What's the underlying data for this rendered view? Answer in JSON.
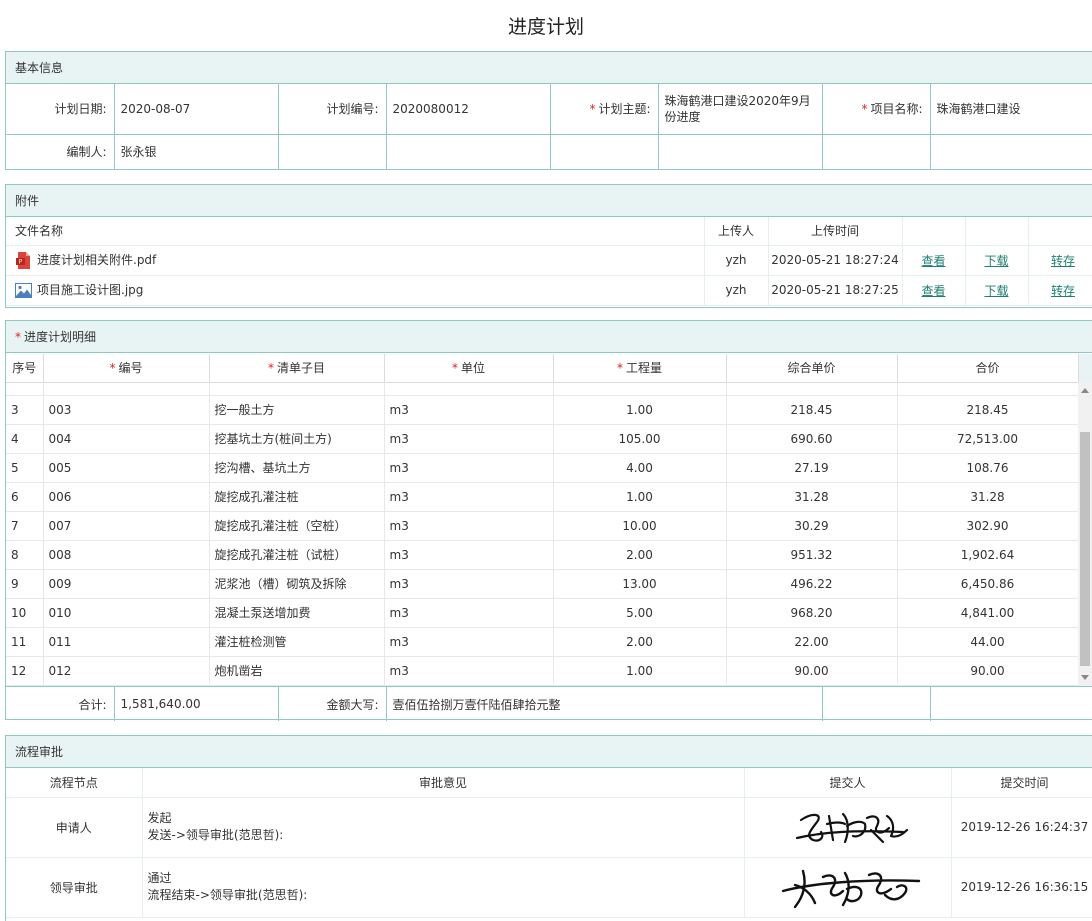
{
  "page": {
    "title": "进度计划"
  },
  "basic": {
    "title": "基本信息",
    "plan_date_label": "计划日期:",
    "plan_date": "2020-08-07",
    "plan_no_label": "计划编号:",
    "plan_no": "2020080012",
    "plan_subject_label": "计划主题:",
    "plan_subject": "珠海鹤港口建设2020年9月份进度",
    "project_name_label": "项目名称:",
    "project_name": "珠海鹤港口建设",
    "author_label": "编制人:",
    "author": "张永银",
    "required_mark": "*"
  },
  "attachments": {
    "title": "附件",
    "headers": {
      "name": "文件名称",
      "uploader": "上传人",
      "time": "上传时间"
    },
    "files": [
      {
        "name": "进度计划相关附件.pdf",
        "icon": "pdf-file-icon",
        "uploader": "yzh",
        "time": "2020-05-21 18:27:24",
        "view": "查看",
        "download": "下载",
        "save": "转存"
      },
      {
        "name": "项目施工设计图.jpg",
        "icon": "image-file-icon",
        "uploader": "yzh",
        "time": "2020-05-21 18:27:25",
        "view": "查看",
        "download": "下载",
        "save": "转存"
      }
    ]
  },
  "detail": {
    "title": "进度计划明细",
    "headers": {
      "seq": "序号",
      "code": "编号",
      "item": "清单子目",
      "unit": "单位",
      "qty": "工程量",
      "price": "综合单价",
      "total": "合价"
    },
    "rows": [
      {
        "seq": "3",
        "code": "003",
        "item": "挖一般土方",
        "unit": "m3",
        "qty": "1.00",
        "price": "218.45",
        "total": "218.45"
      },
      {
        "seq": "4",
        "code": "004",
        "item": "挖基坑土方(桩间土方)",
        "unit": "m3",
        "qty": "105.00",
        "price": "690.60",
        "total": "72,513.00"
      },
      {
        "seq": "5",
        "code": "005",
        "item": "挖沟槽、基坑土方",
        "unit": "m3",
        "qty": "4.00",
        "price": "27.19",
        "total": "108.76"
      },
      {
        "seq": "6",
        "code": "006",
        "item": "旋挖成孔灌注桩",
        "unit": "m3",
        "qty": "1.00",
        "price": "31.28",
        "total": "31.28"
      },
      {
        "seq": "7",
        "code": "007",
        "item": "旋挖成孔灌注桩（空桩）",
        "unit": "m3",
        "qty": "10.00",
        "price": "30.29",
        "total": "302.90"
      },
      {
        "seq": "8",
        "code": "008",
        "item": "旋挖成孔灌注桩（试桩）",
        "unit": "m3",
        "qty": "2.00",
        "price": "951.32",
        "total": "1,902.64"
      },
      {
        "seq": "9",
        "code": "009",
        "item": "泥浆池（槽）砌筑及拆除",
        "unit": "m3",
        "qty": "13.00",
        "price": "496.22",
        "total": "6,450.86"
      },
      {
        "seq": "10",
        "code": "010",
        "item": "混凝土泵送增加费",
        "unit": "m3",
        "qty": "5.00",
        "price": "968.20",
        "total": "4,841.00"
      },
      {
        "seq": "11",
        "code": "011",
        "item": "灌注桩检测管",
        "unit": "m3",
        "qty": "2.00",
        "price": "22.00",
        "total": "44.00"
      },
      {
        "seq": "12",
        "code": "012",
        "item": "炮机凿岩",
        "unit": "m3",
        "qty": "1.00",
        "price": "90.00",
        "total": "90.00"
      }
    ],
    "sum_label": "合计:",
    "sum_value": "1,581,640.00",
    "amount_words_label": "金额大写:",
    "amount_words": "壹佰伍拾捌万壹仟陆佰肆拾元整"
  },
  "flow": {
    "title": "流程审批",
    "headers": {
      "node": "流程节点",
      "opinion": "审批意见",
      "submitter": "提交人",
      "time": "提交时间"
    },
    "rows": [
      {
        "node": "申请人",
        "opinion": "发起",
        "route": "发送->领导审批(范思哲):",
        "time": "2019-12-26 16:24:37"
      },
      {
        "node": "领导审批",
        "opinion": "通过",
        "route": "流程结束->领导审批(范思哲):",
        "time": "2019-12-26 16:36:15"
      }
    ]
  }
}
